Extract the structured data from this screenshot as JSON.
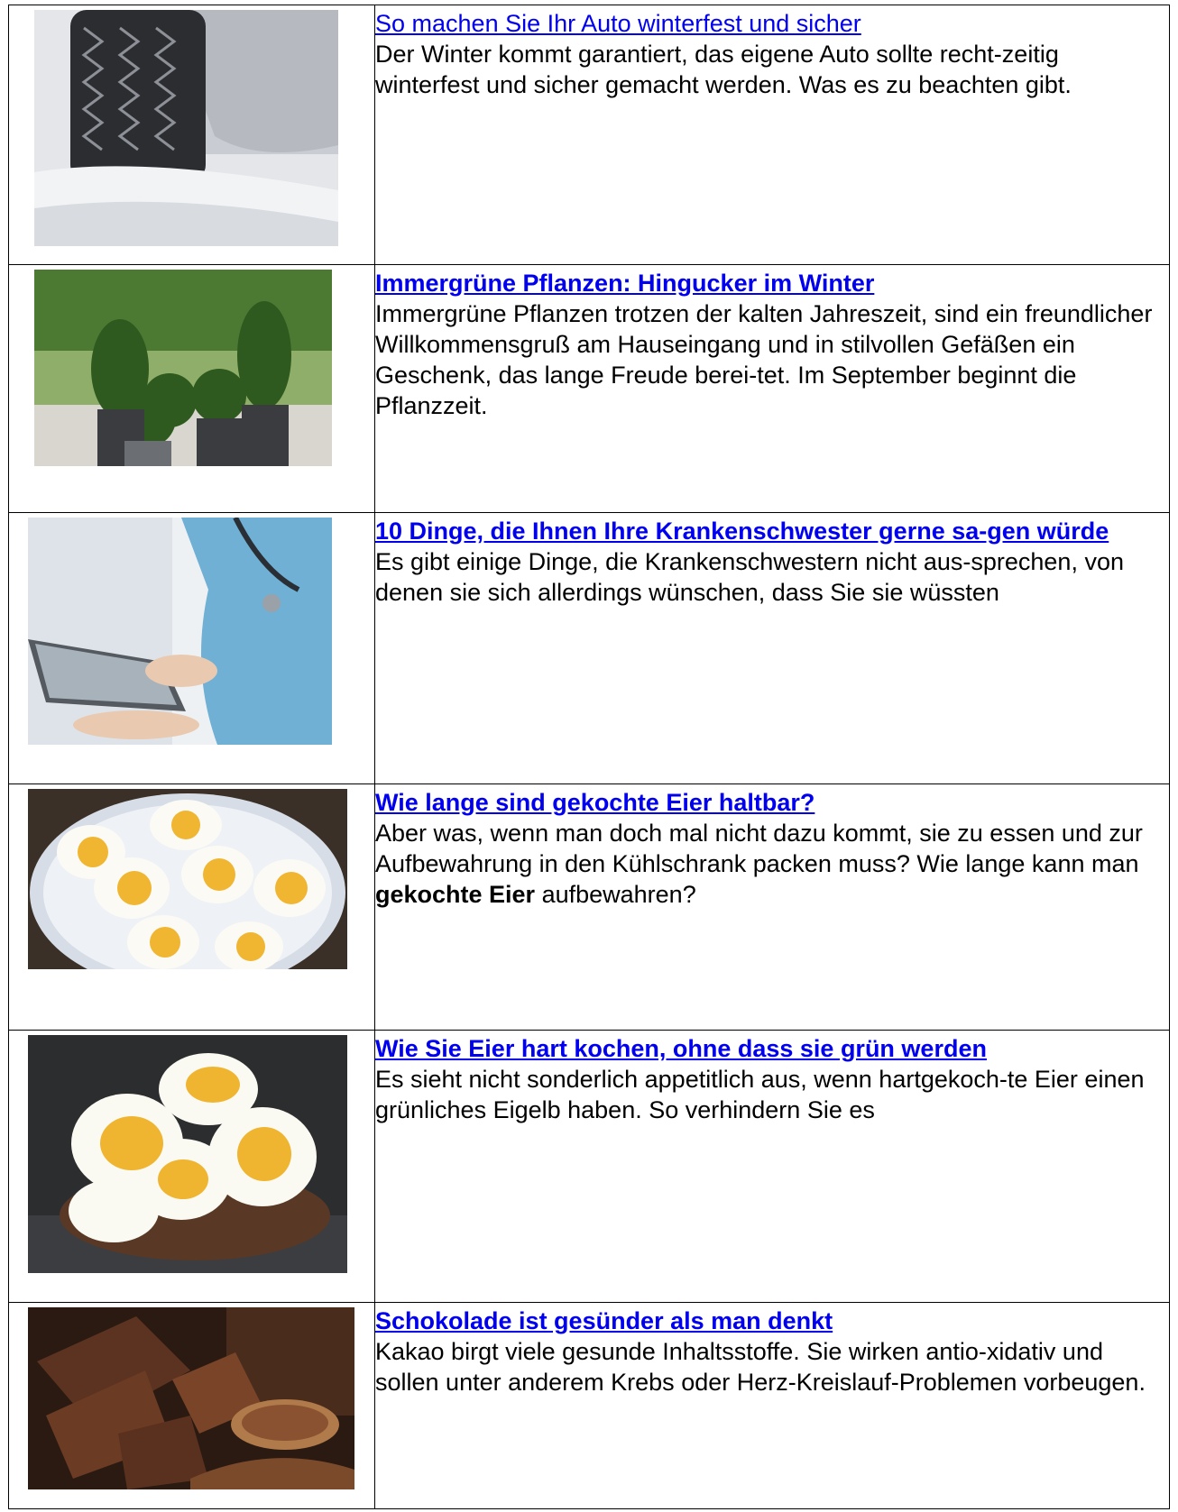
{
  "articles": [
    {
      "image": "winter-tire-in-snow",
      "title": "So machen Sie Ihr Auto winterfest und sicher",
      "title_bold": false,
      "teaser": "Der Winter kommt garantiert, das eigene Auto sollte recht-zeitig winterfest und sicher gemacht werden. Was es zu beachten gibt."
    },
    {
      "image": "evergreen-potted-shrubs",
      "title": "Immergrüne Pflanzen: Hingucker im Winter",
      "title_bold": true,
      "teaser": "Immergrüne Pflanzen trotzen der kalten Jahreszeit, sind ein freundlicher Willkommensgruß am Hauseingang und in stilvollen Gefäßen ein Geschenk, das lange Freude berei-tet. Im September beginnt die Pflanzzeit."
    },
    {
      "image": "nurse-with-tablet",
      "title": "10 Dinge, die Ihnen Ihre Krankenschwester gerne sa-gen würde",
      "title_bold": true,
      "teaser": "Es gibt einige Dinge, die Krankenschwestern nicht aus-sprechen, von denen sie sich allerdings wünschen, dass Sie sie wüssten"
    },
    {
      "image": "boiled-eggs-on-plate",
      "title": "Wie lange sind gekochte Eier haltbar?",
      "title_bold": true,
      "teaser_before": "Aber was, wenn man doch mal nicht dazu kommt, sie zu essen und zur Aufbewahrung in den Kühlschrank packen muss? Wie lange kann man ",
      "teaser_bold": "gekochte Eier",
      "teaser_after": " aufbewahren?"
    },
    {
      "image": "boiled-eggs-in-bowl",
      "title": "Wie Sie Eier hart kochen, ohne dass sie grün werden",
      "title_bold": true,
      "teaser": "Es sieht nicht sonderlich appetitlich aus, wenn hartgekoch-te Eier einen grünliches Eigelb haben. So verhindern Sie es"
    },
    {
      "image": "chocolate-and-cocoa",
      "title": "Schokolade ist gesünder als man denkt",
      "title_bold": true,
      "teaser": "Kakao birgt viele gesunde Inhaltsstoffe.  Sie wirken antio-xidativ und sollen unter anderem Krebs oder Herz-Kreislauf-Problemen vorbeugen."
    }
  ]
}
